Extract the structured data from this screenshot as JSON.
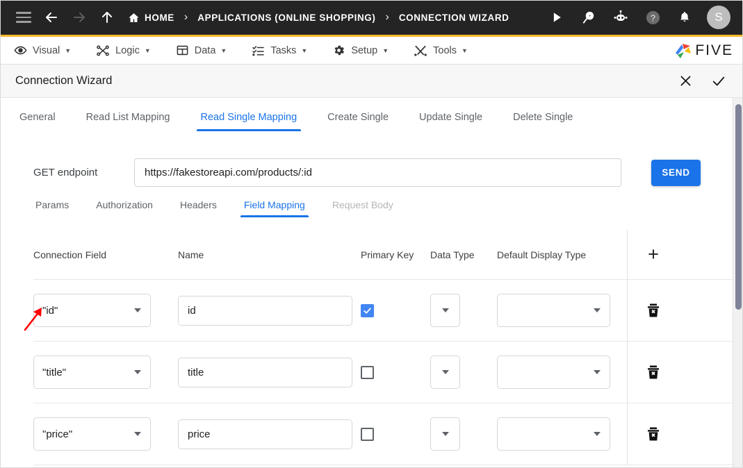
{
  "topbar": {
    "icons": {
      "menu": "hamburger-icon",
      "back": "back-arrow-icon",
      "forward": "forward-arrow-icon",
      "up": "up-arrow-icon",
      "run": "play-icon",
      "search": "search-play-icon",
      "bot": "robot-icon",
      "help": "help-icon",
      "notifications": "bell-icon"
    },
    "breadcrumbs": [
      {
        "label": "HOME",
        "icon": "home-icon"
      },
      {
        "label": "APPLICATIONS (ONLINE SHOPPING)"
      },
      {
        "label": "CONNECTION WIZARD"
      }
    ],
    "separator": "›",
    "avatar_initial": "S",
    "accent_color": "#f5b72a",
    "background_color": "#242424"
  },
  "menubar": {
    "items": [
      {
        "label": "Visual",
        "icon": "eye-icon"
      },
      {
        "label": "Logic",
        "icon": "logic-nodes-icon"
      },
      {
        "label": "Data",
        "icon": "table-icon"
      },
      {
        "label": "Tasks",
        "icon": "checklist-icon"
      },
      {
        "label": "Setup",
        "icon": "gear-icon"
      },
      {
        "label": "Tools",
        "icon": "wrench-screwdriver-icon"
      }
    ],
    "caret": "▼",
    "logo_text": "FIVE"
  },
  "wizard": {
    "title": "Connection Wizard",
    "close_icon": "close-icon",
    "confirm_icon": "check-icon"
  },
  "tabs": [
    {
      "label": "General",
      "active": false
    },
    {
      "label": "Read List Mapping",
      "active": false
    },
    {
      "label": "Read Single Mapping",
      "active": true
    },
    {
      "label": "Create Single",
      "active": false
    },
    {
      "label": "Update Single",
      "active": false
    },
    {
      "label": "Delete Single",
      "active": false
    }
  ],
  "endpoint": {
    "label": "GET endpoint",
    "value": "https://fakestoreapi.com/products/:id",
    "placeholder": "",
    "send_label": "SEND",
    "send_color": "#1a73e8"
  },
  "subtabs": [
    {
      "label": "Params",
      "active": false,
      "disabled": false
    },
    {
      "label": "Authorization",
      "active": false,
      "disabled": false
    },
    {
      "label": "Headers",
      "active": false,
      "disabled": false
    },
    {
      "label": "Field Mapping",
      "active": true,
      "disabled": false
    },
    {
      "label": "Request Body",
      "active": false,
      "disabled": true
    }
  ],
  "mapping_table": {
    "columns": [
      "Connection Field",
      "Name",
      "Primary Key",
      "Data Type",
      "Default Display Type"
    ],
    "add_icon": "plus-icon",
    "delete_icon": "trash-icon",
    "rows": [
      {
        "connection_field": "\"id\"",
        "name": "id",
        "primary_key": true,
        "data_type": "",
        "default_display_type": ""
      },
      {
        "connection_field": "\"title\"",
        "name": "title",
        "primary_key": false,
        "data_type": "",
        "default_display_type": ""
      },
      {
        "connection_field": "\"price\"",
        "name": "price",
        "primary_key": false,
        "data_type": "",
        "default_display_type": ""
      }
    ]
  },
  "annotation": {
    "arrow_color": "#ff0000",
    "points_to": "Params"
  }
}
